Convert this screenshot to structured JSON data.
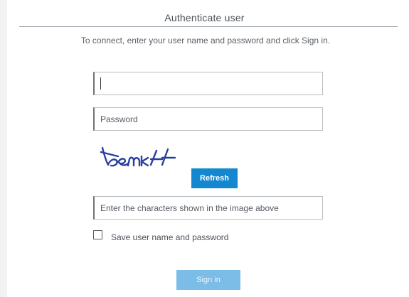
{
  "header": {
    "title": "Authenticate user",
    "subtitle": "To connect, enter your user name and password and click Sign in."
  },
  "form": {
    "username": {
      "value": "",
      "placeholder": ""
    },
    "password": {
      "value": "",
      "placeholder": "Password"
    },
    "captcha_text": "bemk44",
    "refresh_label": "Refresh",
    "captcha_input": {
      "value": "",
      "placeholder": "Enter the characters shown in the image above"
    },
    "remember_label": "Save user name and password",
    "remember_checked": false,
    "signin_label": "Sign in",
    "signin_enabled": false
  },
  "colors": {
    "accent": "#1487d1",
    "disabled_button": "#7cbde8",
    "captcha_ink": "#2b3f9e"
  }
}
